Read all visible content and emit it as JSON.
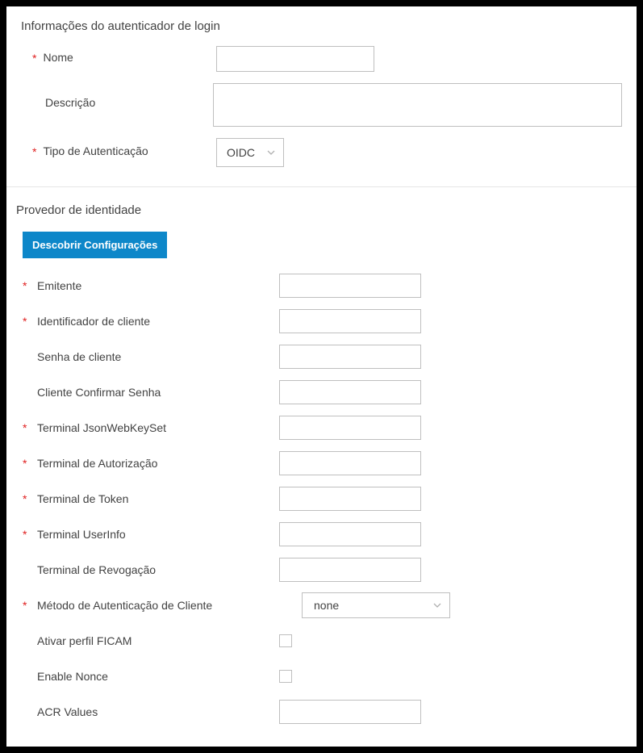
{
  "section1": {
    "title": "Informações do autenticador de login",
    "name_label": "Nome",
    "description_label": "Descrição",
    "auth_type_label": "Tipo de Autenticação",
    "auth_type_value": "OIDC"
  },
  "section2": {
    "title": "Provedor de identidade",
    "discover_btn": "Descobrir Configurações",
    "fields": {
      "issuer": "Emitente",
      "client_id": "Identificador de cliente",
      "client_secret": "Senha de cliente",
      "client_confirm": "Cliente Confirmar Senha",
      "jwks": "Terminal JsonWebKeySet",
      "auth_endpoint": "Terminal de Autorização",
      "token_endpoint": "Terminal de Token",
      "userinfo_endpoint": "Terminal UserInfo",
      "revocation_endpoint": "Terminal de Revogação",
      "client_auth_method": "Método de Autenticação de Cliente",
      "client_auth_method_value": "none",
      "ficam": "Ativar perfil FICAM",
      "nonce": "Enable Nonce",
      "acr": "ACR Values"
    }
  }
}
